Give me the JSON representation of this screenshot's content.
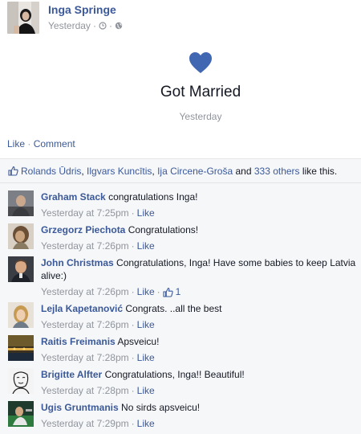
{
  "post": {
    "author": "Inga Springe",
    "time": "Yesterday",
    "meta_sep": "·",
    "event_icon": "heart-icon",
    "event_title": "Got Married",
    "event_date": "Yesterday",
    "actions": {
      "like": "Like",
      "sep": "·",
      "comment": "Comment"
    }
  },
  "likes": {
    "names": [
      {
        "label": "Rolands Ūdris"
      },
      {
        "label": "Ilgvars Kuncītis"
      },
      {
        "label": "Ija Circene-Groša"
      }
    ],
    "and_text": "and",
    "others": "333 others",
    "suffix": "like this."
  },
  "comments": [
    {
      "name": "Graham Stack",
      "text": "congratulations Inga!",
      "time": "Yesterday at 7:25pm",
      "like": "Like",
      "likes": ""
    },
    {
      "name": "Grzegorz Piechota",
      "text": "Congratulations!",
      "time": "Yesterday at 7:26pm",
      "like": "Like",
      "likes": ""
    },
    {
      "name": "John Christmas",
      "text": "Congratulations, Inga! Have some babies to keep Latvia alive:)",
      "time": "Yesterday at 7:26pm",
      "like": "Like",
      "likes": "1"
    },
    {
      "name": "Lejla Kapetanović",
      "text": "Congrats. ..all the best",
      "time": "Yesterday at 7:26pm",
      "like": "Like",
      "likes": ""
    },
    {
      "name": "Raitis Freimanis",
      "text": "Apsveicu!",
      "time": "Yesterday at 7:28pm",
      "like": "Like",
      "likes": ""
    },
    {
      "name": "Brigitte Alfter",
      "text": "Congratulations, Inga!! Beautiful!",
      "time": "Yesterday at 7:28pm",
      "like": "Like",
      "likes": ""
    },
    {
      "name": "Ugis Gruntmanis",
      "text": "No sirds apsveicu!",
      "time": "Yesterday at 7:29pm",
      "like": "Like",
      "likes": ""
    }
  ],
  "colors": {
    "link": "#3b5998",
    "muted": "#90949c",
    "ufi_bg": "#f6f7f9",
    "heart": "#4267b2"
  }
}
